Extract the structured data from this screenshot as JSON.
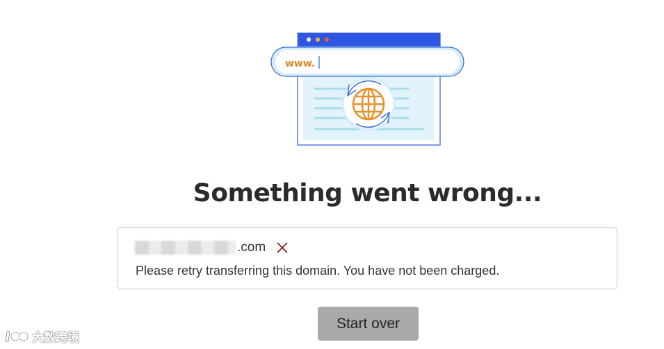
{
  "illustration": {
    "url_text": "www."
  },
  "heading": "Something went wrong...",
  "result": {
    "domain_suffix": ".com",
    "status_icon": "close-icon",
    "message": "Please retry transferring this domain. You have not been charged."
  },
  "actions": {
    "start_over_label": "Start over"
  },
  "watermark": {
    "text": "大数跨境"
  },
  "colors": {
    "browser_bar": "#2f56e0",
    "url_border": "#3a6fd8",
    "globe": "#e8902a",
    "error": "#8b1a1a",
    "button_bg": "#a9a9a9"
  }
}
